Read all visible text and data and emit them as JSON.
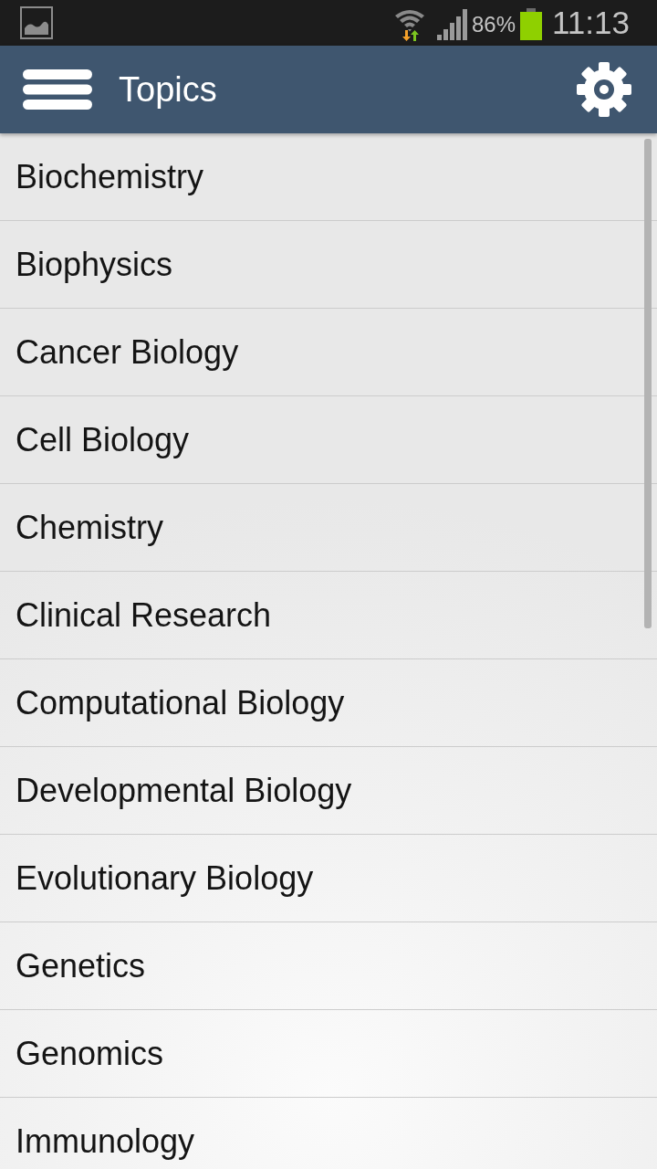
{
  "status_bar": {
    "battery_percent": "86%",
    "time": "11:13"
  },
  "app_bar": {
    "title": "Topics"
  },
  "topics": [
    "Biochemistry",
    "Biophysics",
    "Cancer Biology",
    "Cell Biology",
    "Chemistry",
    "Clinical Research",
    "Computational Biology",
    "Developmental Biology",
    "Evolutionary Biology",
    "Genetics",
    "Genomics",
    "Immunology"
  ]
}
